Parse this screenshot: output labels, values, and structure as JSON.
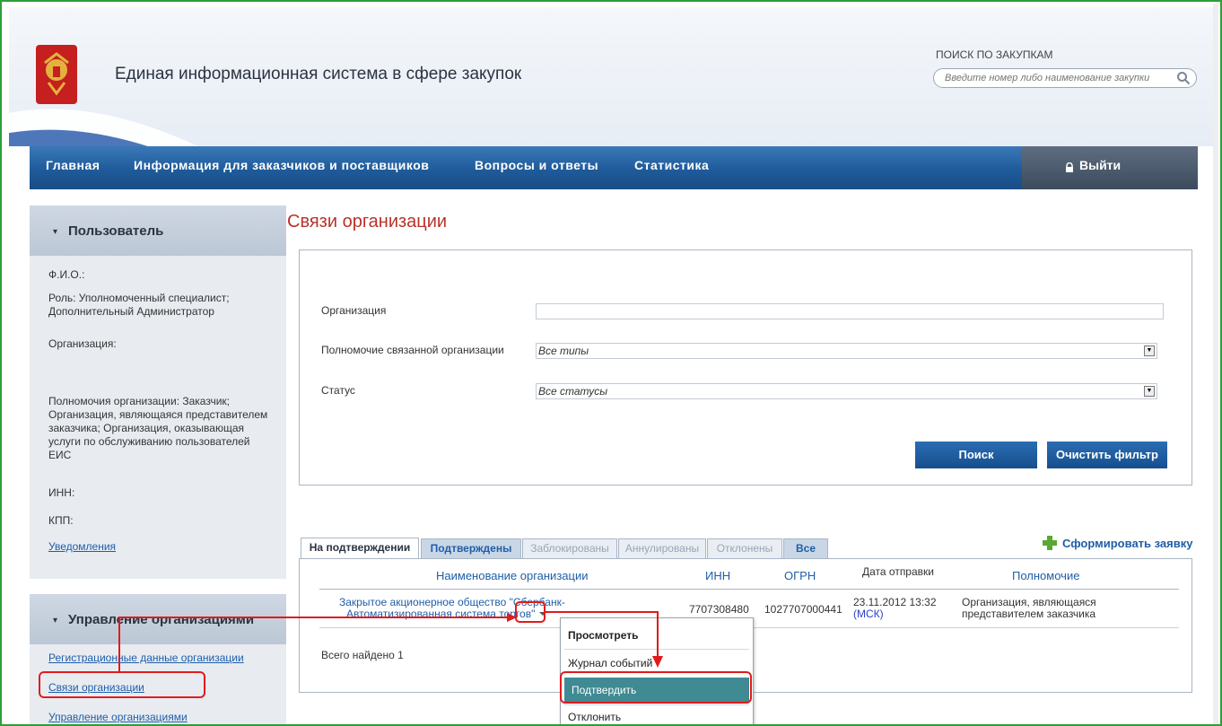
{
  "header": {
    "site_title": "Единая информационная система в сфере закупок",
    "search_caption": "ПОИСК ПО ЗАКУПКАМ",
    "search_placeholder": "Введите номер либо наименование закупки"
  },
  "nav": {
    "items": [
      "Главная",
      "Информация для заказчиков и поставщиков",
      "Вопросы и ответы",
      "Статистика"
    ],
    "logout": "Выйти"
  },
  "sidebar": {
    "user_panel": {
      "title": "Пользователь",
      "fio": "Ф.И.О.:",
      "role": "Роль: Уполномоченный специалист; Дополнительный Администратор",
      "organization": "Организация:",
      "powers": "Полномочия организации: Заказчик; Организация, являющаяся представителем заказчика; Организация, оказывающая услуги по обслуживанию пользователей ЕИС",
      "inn": "ИНН:",
      "kpp": "КПП:",
      "notifications": "Уведомления"
    },
    "org_panel": {
      "title": "Управление организациями",
      "items": [
        "Регистрационные данные организации",
        "Связи организации",
        "Управление организациями"
      ]
    }
  },
  "main": {
    "title": "Связи организации",
    "filter": {
      "organization_label": "Организация",
      "organization_value": "",
      "authority_label": "Полномочие связанной организации",
      "authority_value": "Все типы",
      "status_label": "Статус",
      "status_value": "Все статусы",
      "search_button": "Поиск",
      "clear_button": "Очистить фильтр"
    },
    "create_request": "Сформировать заявку",
    "tabs": [
      {
        "label": "На подтверждении",
        "state": "active"
      },
      {
        "label": "Подтверждены",
        "state": "on"
      },
      {
        "label": "Заблокированы",
        "state": "off"
      },
      {
        "label": "Аннулированы",
        "state": "off"
      },
      {
        "label": "Отклонены",
        "state": "off"
      },
      {
        "label": "Все",
        "state": "on"
      }
    ],
    "table": {
      "columns": [
        "Наименование организации",
        "ИНН",
        "ОГРН",
        "Дата отправки",
        "Полномочие"
      ],
      "rows": [
        {
          "name_line1": "Закрытое акционерное общество \"Сбербанк-",
          "name_line2": "Автоматизированная система торгов\"",
          "inn": "7707308480",
          "ogrn": "1027707000441",
          "date": "23.11.2012 13:32",
          "tz": "(МСК)",
          "authority_line1": "Организация, являющаяся",
          "authority_line2": "представителем заказчика"
        }
      ],
      "total": "Всего найдено 1"
    },
    "context_menu": {
      "items": [
        "Просмотреть",
        "Журнал событий",
        "Подтвердить",
        "Отклонить"
      ]
    }
  },
  "colors": {
    "accent_red": "#e11b1b",
    "nav_blue": "#1f5b9a",
    "title_red": "#b8322a",
    "menu_selected": "#3f8a93"
  }
}
